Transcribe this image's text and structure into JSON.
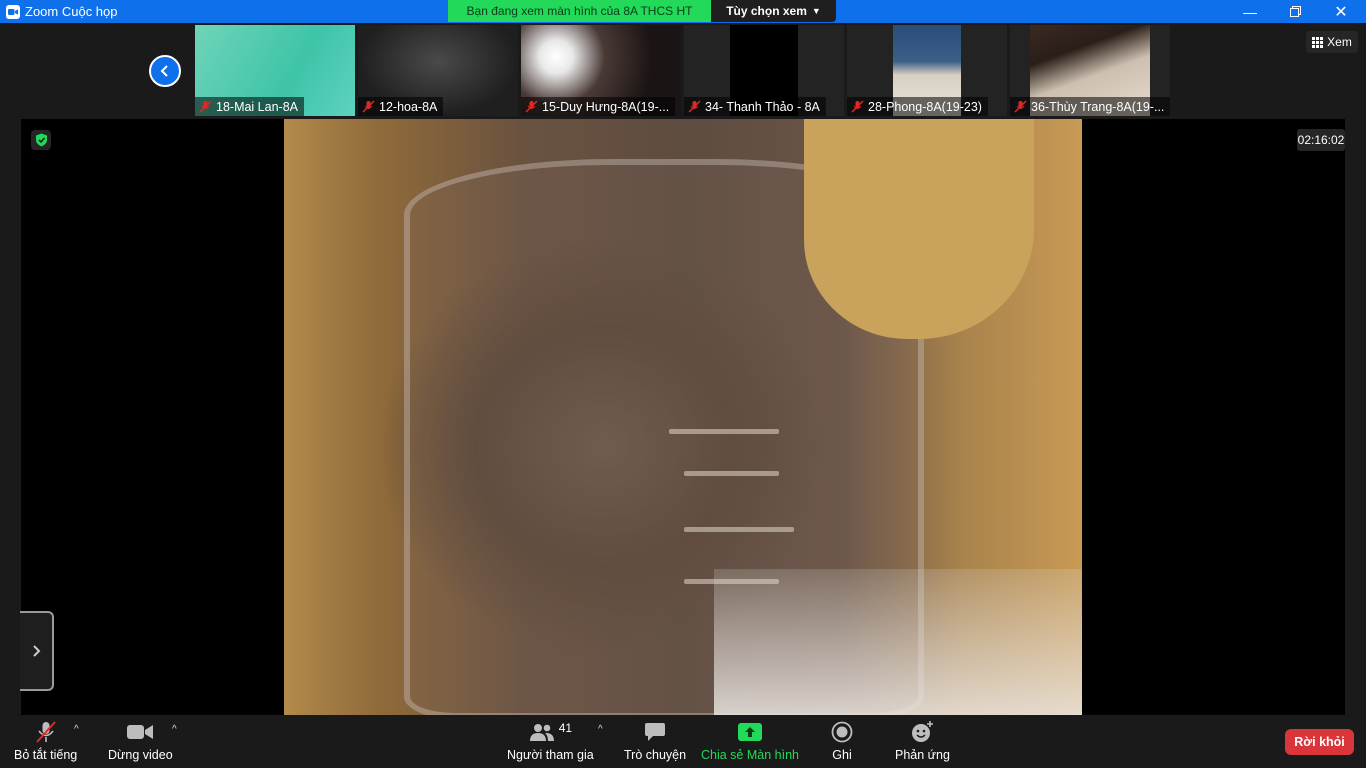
{
  "window": {
    "title": "Zoom Cuộc họp"
  },
  "banner": {
    "sharing_text": "Bạn đang xem màn hình của 8A THCS HT",
    "view_options_label": "Tùy chọn xem"
  },
  "gallery": {
    "view_label": "Xem",
    "participants": [
      {
        "name": "18-Mai Lan-8A"
      },
      {
        "name": "12-hoa-8A"
      },
      {
        "name": "15-Duy Hưng-8A(19-..."
      },
      {
        "name": "34- Thanh Thảo - 8A"
      },
      {
        "name": "28-Phong-8A(19-23)"
      },
      {
        "name": "36-Thùy Trang-8A(19-..."
      }
    ]
  },
  "meeting": {
    "elapsed_time": "02:16:02"
  },
  "toolbar": {
    "mute_label": "Bỏ tắt tiếng",
    "video_label": "Dừng video",
    "participants_label": "Người tham gia",
    "participants_count": "41",
    "chat_label": "Trò chuyện",
    "share_label": "Chia sẻ Màn hình",
    "record_label": "Ghi",
    "reactions_label": "Phản ứng",
    "leave_label": "Rời khỏi"
  },
  "colors": {
    "titlebar": "#0e71eb",
    "share_green": "#23d959",
    "leave_red": "#d9363b",
    "mic_off_red": "#e02828"
  }
}
